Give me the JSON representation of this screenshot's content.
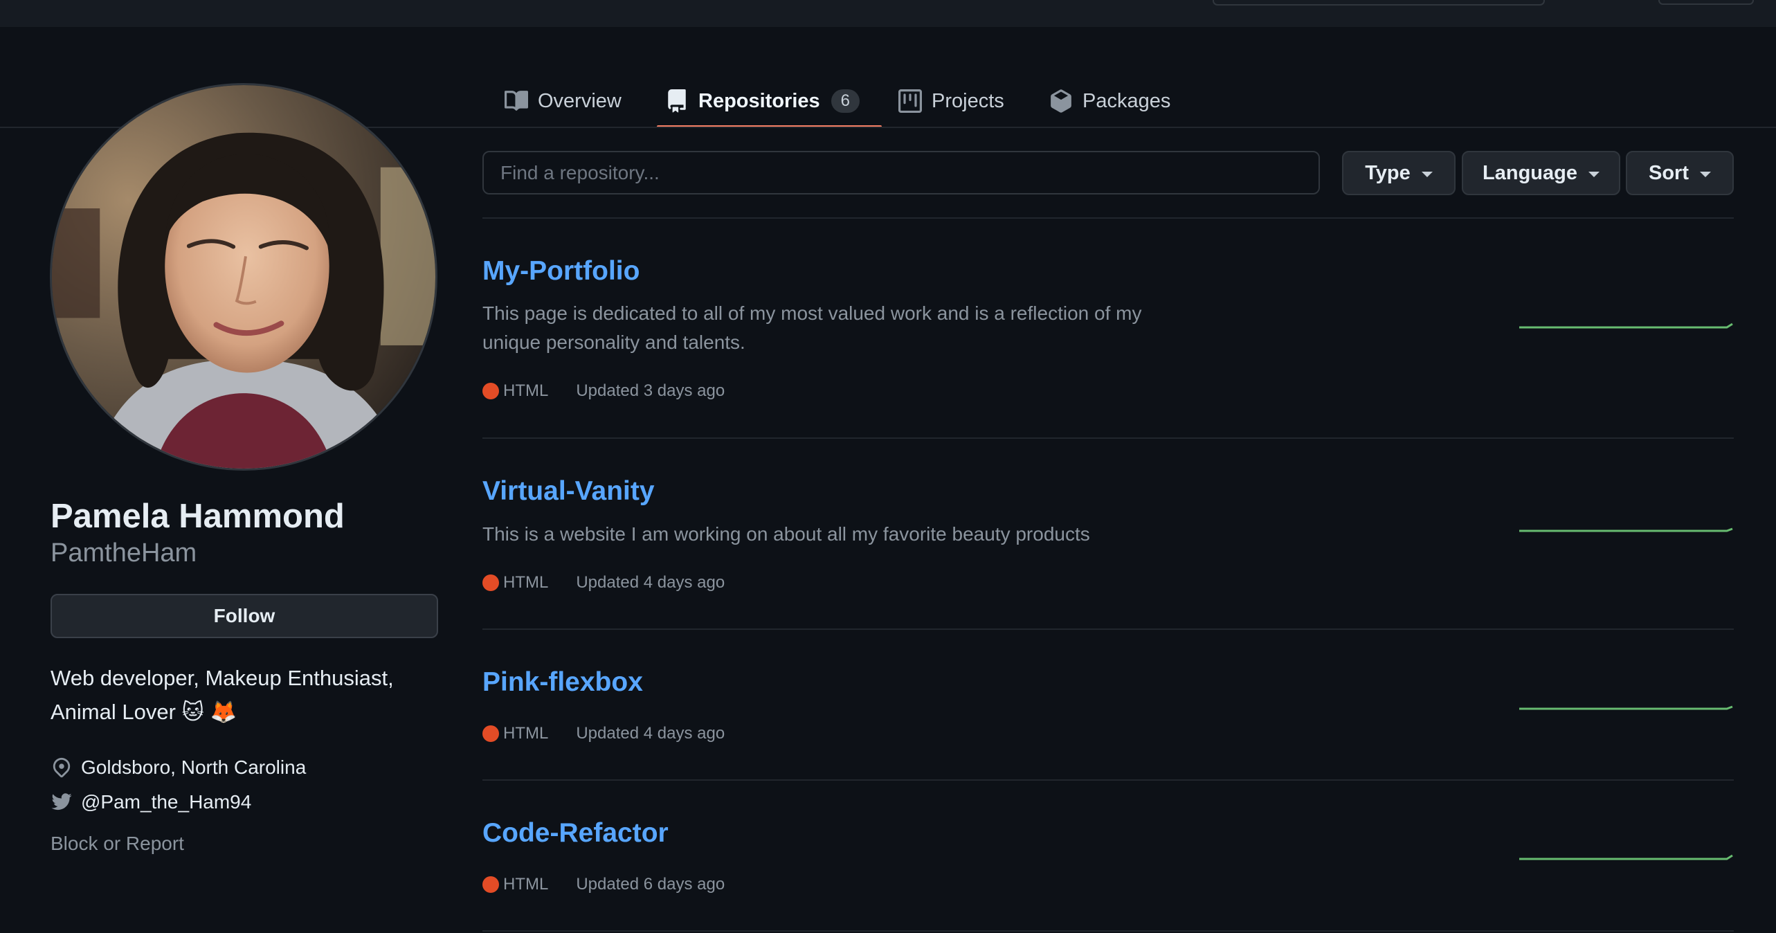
{
  "tabs": [
    {
      "label": "Overview",
      "icon": "book-icon"
    },
    {
      "label": "Repositories",
      "icon": "repo-icon",
      "count": "6"
    },
    {
      "label": "Projects",
      "icon": "project-icon"
    },
    {
      "label": "Packages",
      "icon": "package-icon"
    }
  ],
  "profile": {
    "name": "Pamela Hammond",
    "login": "PamtheHam",
    "follow_label": "Follow",
    "bio": "Web developer, Makeup Enthusiast, Animal Lover 🐱 🦊",
    "location": "Goldsboro, North Carolina",
    "twitter": "@Pam_the_Ham94",
    "block_report": "Block or Report"
  },
  "search": {
    "placeholder": "Find a repository..."
  },
  "filters": {
    "type": "Type",
    "language": "Language",
    "sort": "Sort"
  },
  "repos": [
    {
      "name": "My-Portfolio",
      "description": "This page is dedicated to all of my most valued work and is a reflection of my unique personality and talents.",
      "language": "HTML",
      "updated": "Updated 3 days ago"
    },
    {
      "name": "Virtual-Vanity",
      "description": "This is a website I am working on about all my favorite beauty products",
      "language": "HTML",
      "updated": "Updated 4 days ago"
    },
    {
      "name": "Pink-flexbox",
      "description": "",
      "language": "HTML",
      "updated": "Updated 4 days ago"
    },
    {
      "name": "Code-Refactor",
      "description": "",
      "language": "HTML",
      "updated": "Updated 6 days ago"
    }
  ],
  "colors": {
    "accent_link": "#58a6ff",
    "tab_underline": "#f78166",
    "html_language": "#e34c26",
    "sparkline": "#7ee787"
  }
}
